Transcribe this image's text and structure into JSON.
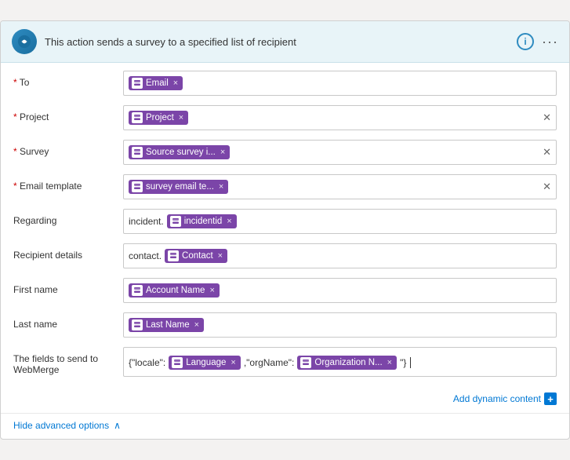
{
  "header": {
    "title": "This action sends a survey to a specified list of recipient",
    "info_label": "i",
    "dots_label": "···"
  },
  "form": {
    "rows": [
      {
        "id": "to",
        "label": "* To",
        "required": true,
        "prefix": "",
        "tokens": [
          {
            "label": "Email",
            "icon": true
          }
        ],
        "has_clear": false,
        "text_content": ""
      },
      {
        "id": "project",
        "label": "* Project",
        "required": true,
        "prefix": "",
        "tokens": [
          {
            "label": "Project",
            "icon": true
          }
        ],
        "has_clear": true,
        "text_content": ""
      },
      {
        "id": "survey",
        "label": "* Survey",
        "required": true,
        "prefix": "",
        "tokens": [
          {
            "label": "Source survey i...",
            "icon": true
          }
        ],
        "has_clear": true,
        "text_content": ""
      },
      {
        "id": "email-template",
        "label": "* Email template",
        "required": true,
        "prefix": "",
        "tokens": [
          {
            "label": "survey email te...",
            "icon": true
          }
        ],
        "has_clear": true,
        "text_content": ""
      },
      {
        "id": "regarding",
        "label": "Regarding",
        "required": false,
        "prefix": "incident.",
        "tokens": [
          {
            "label": "incidentid",
            "icon": true
          }
        ],
        "has_clear": false,
        "text_content": ""
      },
      {
        "id": "recipient-details",
        "label": "Recipient details",
        "required": false,
        "prefix": "contact.",
        "tokens": [
          {
            "label": "Contact",
            "icon": true
          }
        ],
        "has_clear": false,
        "text_content": ""
      },
      {
        "id": "first-name",
        "label": "First name",
        "required": false,
        "prefix": "",
        "tokens": [
          {
            "label": "Account Name",
            "icon": true
          }
        ],
        "has_clear": false,
        "text_content": ""
      },
      {
        "id": "last-name",
        "label": "Last name",
        "required": false,
        "prefix": "",
        "tokens": [
          {
            "label": "Last Name",
            "icon": true
          }
        ],
        "has_clear": false,
        "text_content": ""
      },
      {
        "id": "webmerge",
        "label": "The fields to send to WebMerge",
        "required": false,
        "multiline": true,
        "prefix": "{\"locale\":",
        "tokens": [
          {
            "label": "Language",
            "icon": true
          },
          {
            "label": null,
            "icon": false,
            "plain": " ,\"orgName\":"
          },
          {
            "label": "Organization N...",
            "icon": true
          }
        ],
        "suffix": " \"}",
        "has_clear": false
      }
    ]
  },
  "add_dynamic": "Add dynamic content",
  "hide_advanced": "Hide advanced options"
}
